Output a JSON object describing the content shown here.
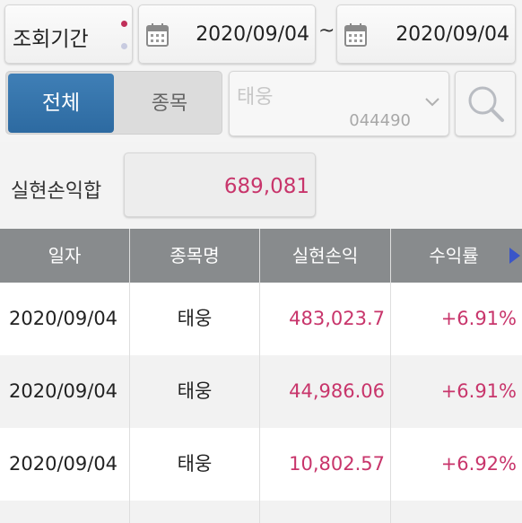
{
  "period": {
    "label": "조회기간",
    "start_date": "2020/09/04",
    "separator": "~",
    "end_date": "2020/09/04"
  },
  "filter": {
    "tabs": [
      {
        "label": "전체",
        "selected": true
      },
      {
        "label": "종목",
        "selected": false
      }
    ],
    "stock_name": "태웅",
    "stock_code": "044490"
  },
  "summary": {
    "label": "실현손익합",
    "value": "689,081"
  },
  "table": {
    "headers": [
      "일자",
      "종목명",
      "실현손익",
      "수익률"
    ],
    "rows": [
      {
        "date": "2020/09/04",
        "name": "태웅",
        "profit": "483,023.7",
        "rate": "+6.91%"
      },
      {
        "date": "2020/09/04",
        "name": "태웅",
        "profit": "44,986.06",
        "rate": "+6.91%"
      },
      {
        "date": "2020/09/04",
        "name": "태웅",
        "profit": "10,802.57",
        "rate": "+6.92%"
      }
    ]
  },
  "colors": {
    "accent": "#2d6aa1",
    "profit": "#c8356b",
    "header_bg": "#888b8d"
  },
  "icons": [
    "calendar-icon",
    "chevron-down-icon",
    "search-icon",
    "scroll-right-icon"
  ]
}
